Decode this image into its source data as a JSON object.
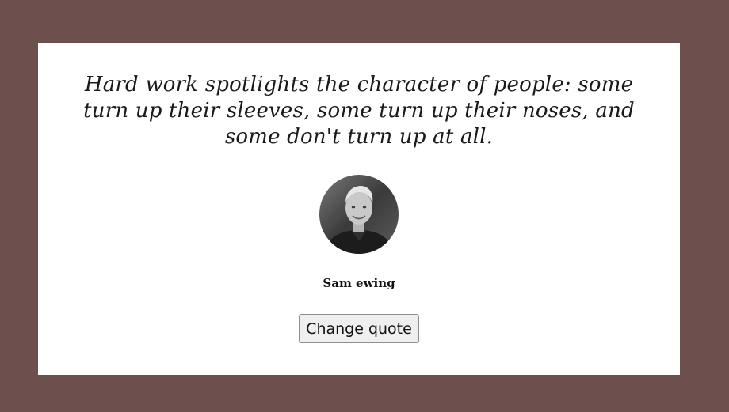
{
  "quote": {
    "text": "Hard work spotlights the character of people: some turn up their sleeves, some turn up their noses, and some don't turn up at all.",
    "author": "Sam ewing"
  },
  "actions": {
    "change_label": "Change quote"
  },
  "colors": {
    "background": "#6d504e",
    "card": "#ffffff"
  }
}
